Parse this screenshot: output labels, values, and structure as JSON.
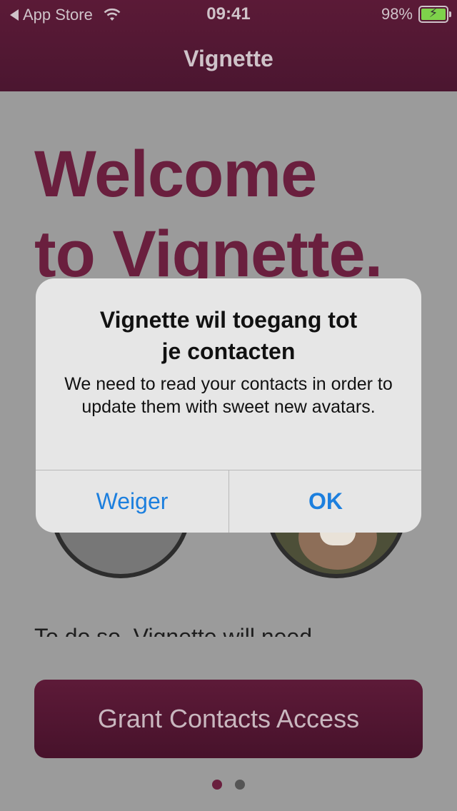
{
  "status_bar": {
    "back_label": "App Store",
    "time": "09:41",
    "battery": "98%"
  },
  "nav": {
    "title": "Vignette"
  },
  "welcome": {
    "line1": "Welcome",
    "line2": "to Vignette."
  },
  "body_text": "To do so, Vignette will need",
  "grant_button": "Grant Contacts Access",
  "page_indicator": {
    "count": 2,
    "active": 1
  },
  "alert": {
    "title_line1": "Vignette wil toegang tot",
    "title_line2": "je contacten",
    "message": "We need to read your contacts in order to update them with sweet new avatars.",
    "deny_label": "Weiger",
    "ok_label": "OK"
  },
  "colors": {
    "brand": "#5b1a37",
    "alert_button": "#1c7fde",
    "battery_fill": "#7ed24b"
  }
}
